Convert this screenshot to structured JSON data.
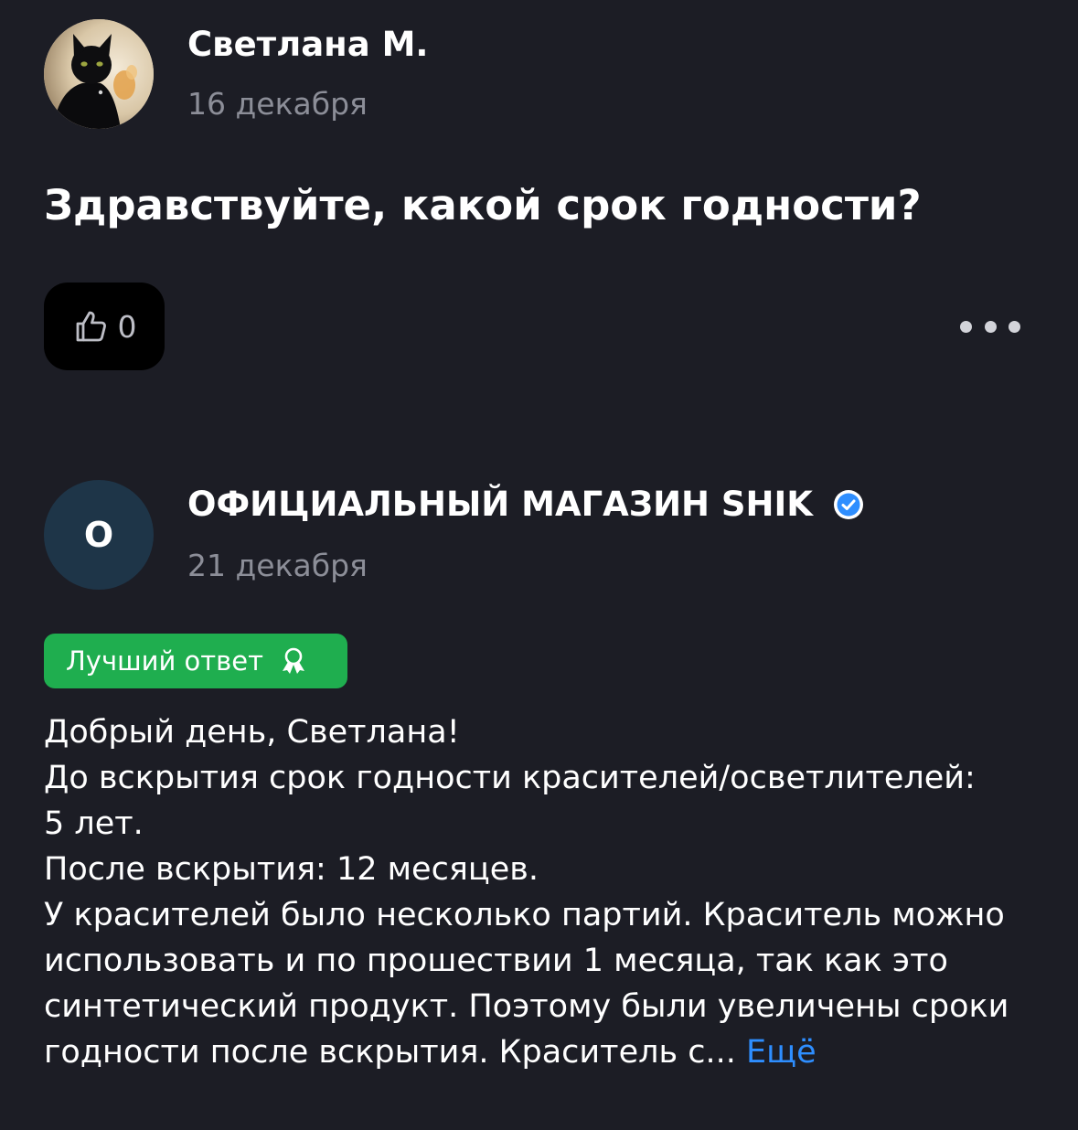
{
  "question_author": {
    "name": "Светлана М.",
    "date": "16 декабря",
    "avatar_icon": "black-cat-photo"
  },
  "question": {
    "text": "Здравствуйте, какой срок годности?",
    "likes": "0",
    "like_icon": "thumb-up-icon",
    "more_icon": "more-dots-icon"
  },
  "answer_author": {
    "name": "ОФИЦИАЛЬНЫЙ МАГАЗИН SHIK",
    "avatar_letter": "О",
    "date": "21 декабря",
    "verified_icon": "verified-check-icon",
    "verified_color": "#2e8eff"
  },
  "answer": {
    "badge": "Лучший ответ",
    "badge_icon": "award-icon",
    "badge_color": "#1fae4f",
    "lines": [
      "Добрый день, Светлана!",
      "До вскрытия срок годности красителей/осветлителей:",
      "5 лет.",
      "После вскрытия: 12 месяцев.",
      "У красителей было несколько партий. Краситель можно",
      "использовать и по прошествии 1 месяца, так как это",
      "синтетический продукт. Поэтому были увеличены сроки",
      "годности после вскрытия. Краситель с..."
    ],
    "more_label": "Ещё",
    "more_color": "#2e8eff"
  }
}
